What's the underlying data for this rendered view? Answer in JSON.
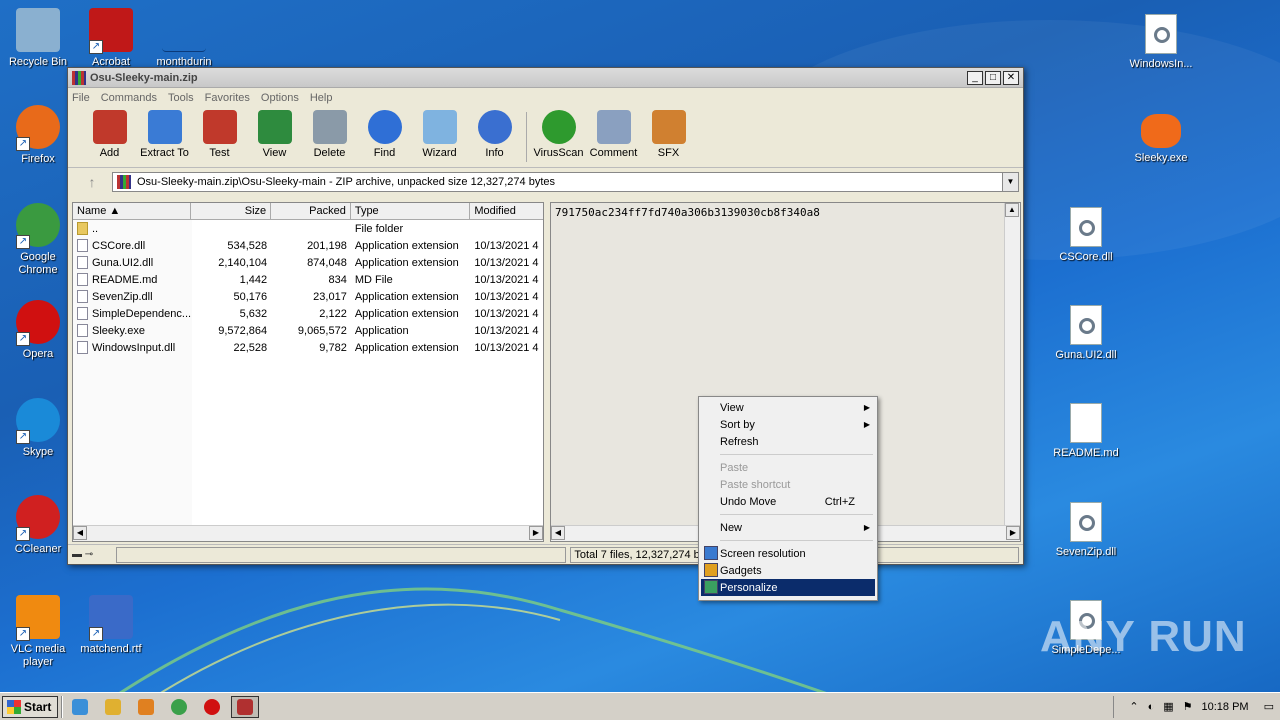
{
  "desktop": {
    "left_icons": [
      {
        "label": "Recycle Bin",
        "icon": "recycle-bin-icon"
      },
      {
        "label": "Acrobat",
        "icon": "acrobat-icon"
      },
      {
        "label": "monthdurin",
        "icon": "file-icon"
      },
      {
        "label": "Firefox",
        "icon": "firefox-icon"
      },
      {
        "label": "Google Chrome",
        "icon": "chrome-icon"
      },
      {
        "label": "Opera",
        "icon": "opera-icon"
      },
      {
        "label": "Skype",
        "icon": "skype-icon"
      },
      {
        "label": "CCleaner",
        "icon": "ccleaner-icon"
      },
      {
        "label": "VLC media player",
        "icon": "vlc-icon"
      },
      {
        "label": "matchend.rtf",
        "icon": "word-document-icon"
      }
    ],
    "right_icons": [
      {
        "label": "WindowsIn...",
        "icon": "dll-file-icon"
      },
      {
        "label": "Sleeky.exe",
        "icon": "discord-icon"
      },
      {
        "label": "CSCore.dll",
        "icon": "dll-file-icon"
      },
      {
        "label": "Guna.UI2.dll",
        "icon": "dll-file-icon"
      },
      {
        "label": "README.md",
        "icon": "text-file-icon"
      },
      {
        "label": "SevenZip.dll",
        "icon": "dll-file-icon"
      },
      {
        "label": "SimpleDepe...",
        "icon": "dll-file-icon"
      }
    ],
    "watermark": "ANY RUN"
  },
  "window": {
    "title": "Osu-Sleeky-main.zip",
    "controls": {
      "minimize": "_",
      "maximize": "□",
      "close": "✕"
    },
    "menu": [
      "File",
      "Commands",
      "Tools",
      "Favorites",
      "Options",
      "Help"
    ],
    "toolbar": [
      {
        "label": "Add",
        "color": "#c0392b"
      },
      {
        "label": "Extract To",
        "color": "#3a7bd5"
      },
      {
        "label": "Test",
        "color": "#c0392b"
      },
      {
        "label": "View",
        "color": "#2e8b3e"
      },
      {
        "label": "Delete",
        "color": "#8a9aa8"
      },
      {
        "label": "Find",
        "color": "#2f6fd6"
      },
      {
        "label": "Wizard",
        "color": "#7fb3e0"
      },
      {
        "label": "Info",
        "color": "#3a6fd0"
      },
      {
        "label": "VirusScan",
        "color": "#2e9a2e"
      },
      {
        "label": "Comment",
        "color": "#8aa0c0"
      },
      {
        "label": "SFX",
        "color": "#d08030"
      }
    ],
    "address": "Osu-Sleeky-main.zip\\Osu-Sleeky-main - ZIP archive, unpacked size 12,327,274 bytes",
    "columns": {
      "name": "Name",
      "size": "Size",
      "packed": "Packed",
      "type": "Type",
      "modified": "Modified"
    },
    "files": [
      {
        "name": "..",
        "size": "",
        "packed": "",
        "type": "File folder",
        "modified": "",
        "folder": true
      },
      {
        "name": "CSCore.dll",
        "size": "534,528",
        "packed": "201,198",
        "type": "Application extension",
        "modified": "10/13/2021 4"
      },
      {
        "name": "Guna.UI2.dll",
        "size": "2,140,104",
        "packed": "874,048",
        "type": "Application extension",
        "modified": "10/13/2021 4"
      },
      {
        "name": "README.md",
        "size": "1,442",
        "packed": "834",
        "type": "MD File",
        "modified": "10/13/2021 4"
      },
      {
        "name": "SevenZip.dll",
        "size": "50,176",
        "packed": "23,017",
        "type": "Application extension",
        "modified": "10/13/2021 4"
      },
      {
        "name": "SimpleDependenc...",
        "size": "5,632",
        "packed": "2,122",
        "type": "Application extension",
        "modified": "10/13/2021 4"
      },
      {
        "name": "Sleeky.exe",
        "size": "9,572,864",
        "packed": "9,065,572",
        "type": "Application",
        "modified": "10/13/2021 4"
      },
      {
        "name": "WindowsInput.dll",
        "size": "22,528",
        "packed": "9,782",
        "type": "Application extension",
        "modified": "10/13/2021 4"
      }
    ],
    "hash": "791750ac234ff7fd740a306b3139030cb8f340a8",
    "status": "Total 7 files, 12,327,274 b"
  },
  "context_menu": {
    "items": [
      {
        "label": "View",
        "submenu": true
      },
      {
        "label": "Sort by",
        "submenu": true
      },
      {
        "label": "Refresh"
      },
      {
        "sep": true
      },
      {
        "label": "Paste",
        "disabled": true
      },
      {
        "label": "Paste shortcut",
        "disabled": true
      },
      {
        "label": "Undo Move",
        "shortcut": "Ctrl+Z"
      },
      {
        "sep": true
      },
      {
        "label": "New",
        "submenu": true
      },
      {
        "sep": true
      },
      {
        "label": "Screen resolution",
        "icon": "screen-resolution-icon"
      },
      {
        "label": "Gadgets",
        "icon": "gadgets-icon"
      },
      {
        "label": "Personalize",
        "icon": "personalize-icon",
        "highlighted": true
      }
    ]
  },
  "taskbar": {
    "start": "Start",
    "pinned": [
      {
        "name": "internet-explorer-icon",
        "color": "#3a8fd8"
      },
      {
        "name": "explorer-icon",
        "color": "#e0b030"
      },
      {
        "name": "media-player-icon",
        "color": "#e08020"
      },
      {
        "name": "chrome-taskbar-icon",
        "color": "#3aa04a"
      },
      {
        "name": "opera-taskbar-icon",
        "color": "#d01010"
      },
      {
        "name": "winrar-taskbar-icon",
        "color": "#b03030"
      }
    ],
    "clock": "10:18 PM"
  }
}
